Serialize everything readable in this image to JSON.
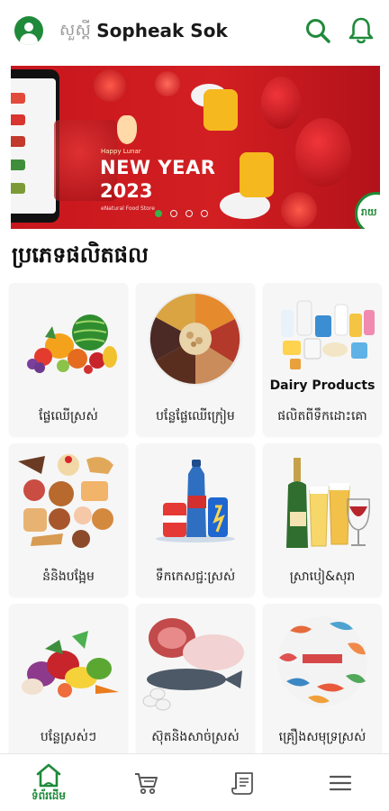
{
  "header": {
    "greeting": "សួស្តី",
    "username": "Sopheak Sok",
    "icons": [
      "user-avatar-icon",
      "search-icon",
      "bell-icon"
    ]
  },
  "banner": {
    "tagline": "Happy Lunar",
    "headline_line1": "NEW YEAR",
    "headline_line2": "2023",
    "brand": "eNatural Food Store",
    "stamp_text": "រាយ",
    "slide_count": 4,
    "active_slide": 1
  },
  "section": {
    "title": "ប្រភេទផលិតផល"
  },
  "categories": [
    {
      "label": "ផ្លែឈើស្រស់",
      "image_text": ""
    },
    {
      "label": "បន្លែផ្លែឈើក្រៀម",
      "image_text": ""
    },
    {
      "label": "ផលិតពីទឹកដោះគោ",
      "image_text": "Dairy Products"
    },
    {
      "label": "នំនិងបង្អែម",
      "image_text": ""
    },
    {
      "label": "ទឹកកេសជ្ជៈស្រស់",
      "image_text": ""
    },
    {
      "label": "ស្រាបៀ&សុរា",
      "image_text": ""
    },
    {
      "label": "បន្លែស្រស់ៗ",
      "image_text": ""
    },
    {
      "label": "ស៊ុតនិងសាច់ស្រស់",
      "image_text": ""
    },
    {
      "label": "គ្រឿងសមុទ្រស្រស់",
      "image_text": ""
    }
  ],
  "bottom_nav": {
    "items": [
      {
        "icon": "home-icon",
        "label": "ទំព័រដើម",
        "active": true
      },
      {
        "icon": "cart-icon",
        "label": "",
        "active": false
      },
      {
        "icon": "receipt-icon",
        "label": "",
        "active": false
      },
      {
        "icon": "menu-icon",
        "label": "",
        "active": false
      }
    ]
  },
  "colors": {
    "brand_green": "#1f8a3a",
    "banner_red": "#c7161d",
    "card_bg": "#f6f6f6"
  }
}
